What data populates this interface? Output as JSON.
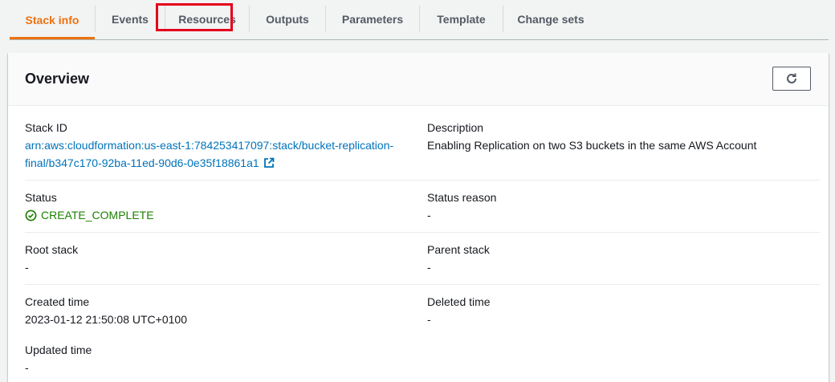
{
  "tabs": [
    {
      "label": "Stack info",
      "active": true
    },
    {
      "label": "Events"
    },
    {
      "label": "Resources"
    },
    {
      "label": "Outputs"
    },
    {
      "label": "Parameters"
    },
    {
      "label": "Template"
    },
    {
      "label": "Change sets"
    }
  ],
  "overview": {
    "title": "Overview",
    "refresh_icon": "refresh-icon",
    "fields": {
      "stack_id": {
        "label": "Stack ID",
        "value_line1": "arn:aws:cloudformation:us-east-1:784253417097:stack/bucket-replication-",
        "value_line2": "final/b347c170-92ba-11ed-90d6-0e35f18861a1"
      },
      "description": {
        "label": "Description",
        "value": "Enabling Replication on two S3 buckets in the same AWS Account"
      },
      "status": {
        "label": "Status",
        "value": "CREATE_COMPLETE",
        "color": "#1d8102"
      },
      "status_reason": {
        "label": "Status reason",
        "value": "-"
      },
      "root_stack": {
        "label": "Root stack",
        "value": "-"
      },
      "parent_stack": {
        "label": "Parent stack",
        "value": "-"
      },
      "created_time": {
        "label": "Created time",
        "value": "2023-01-12 21:50:08 UTC+0100"
      },
      "deleted_time": {
        "label": "Deleted time",
        "value": "-"
      },
      "updated_time": {
        "label": "Updated time",
        "value": "-"
      }
    }
  },
  "colors": {
    "accent": "#ec7211",
    "link": "#0073bb",
    "highlight": "#e4001b"
  }
}
